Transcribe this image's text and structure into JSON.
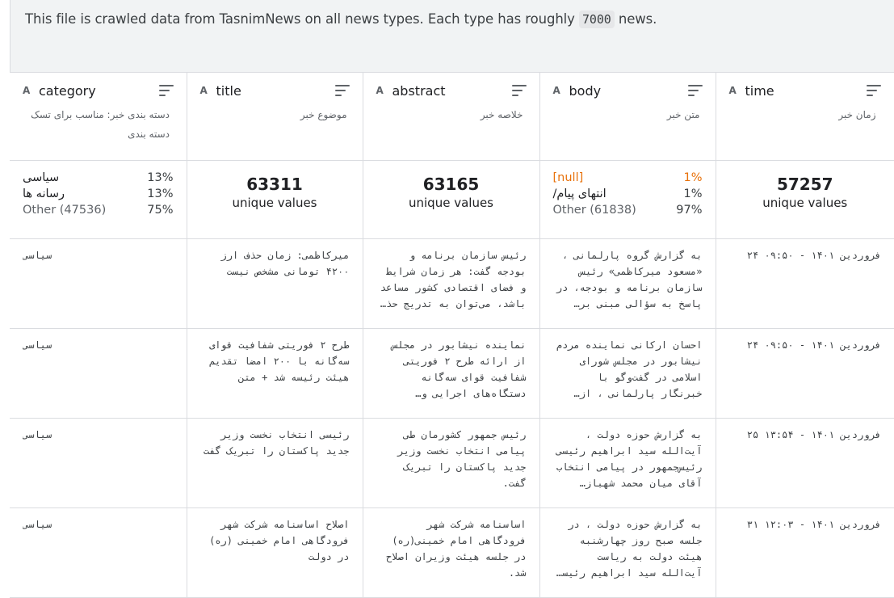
{
  "description": {
    "before": "This file is crawled data from TasnimNews on all news types. Each type has roughly ",
    "code": "7000",
    "after": " news."
  },
  "columns": [
    {
      "name": "category",
      "type_icon": "string-type-icon",
      "type_glyph": "A",
      "desc": "دسته بندی خبر: مناسب برای تسک دسته بندی"
    },
    {
      "name": "title",
      "type_icon": "string-type-icon",
      "type_glyph": "A",
      "desc": "موضوع خبر"
    },
    {
      "name": "abstract",
      "type_icon": "string-type-icon",
      "type_glyph": "A",
      "desc": "خلاصه خبر"
    },
    {
      "name": "body",
      "type_icon": "string-type-icon",
      "type_glyph": "A",
      "desc": "متن خبر"
    },
    {
      "name": "time",
      "type_icon": "string-type-icon",
      "type_glyph": "A",
      "desc": "زمان خبر"
    }
  ],
  "stats": {
    "category": [
      {
        "label": "سیاسی",
        "pct": "13%"
      },
      {
        "label": "رسانه ها",
        "pct": "13%"
      },
      {
        "label": "Other (47536)",
        "pct": "75%"
      }
    ],
    "title": {
      "count": "63311",
      "label": "unique values"
    },
    "abstract": {
      "count": "63165",
      "label": "unique values"
    },
    "body": [
      {
        "label": "[null]",
        "pct": "1%"
      },
      {
        "label": "/انتهای پیام",
        "pct": "1%"
      },
      {
        "label": "Other (61838)",
        "pct": "97%"
      }
    ],
    "time": {
      "count": "57257",
      "label": "unique values"
    }
  },
  "rows": [
    {
      "category": "سیاسی",
      "title": "میرکاظمی: زمان حذف ارز ۴۲۰۰ تومانی مشخص نیست",
      "abstract": "رئیس سازمان برنامه و بودجه گفت: هر زمان شرایط و فضای اقتصادی کشور مساعد باشد، می‌توان به تدریج حذف ...",
      "body": "به گزارش گروه پارلمانی ، «مسعود میرکاظمی» رئیس سازمان برنامه و بودجه، در پاسخ به سؤالی مبنی بر اینک...",
      "time": "فروردین ۱۴۰۱ - ۰۹:۵۰ ۲۴"
    },
    {
      "category": "سیاسی",
      "title": "طرح ۲ فوریتی شفافیت قوای سه‌گانه با ۲۰۰ امضا تقدیم هیئت رئیسه شد + متن",
      "abstract": "نماینده نیشابور در مجلس از ارائه طرح ۲ فوریتی شفافیت قوای سه‌گانه دستگاه‌های اجرایی و نهادهای عمومی...",
      "body": "احسان ارکانی نماینده مردم نیشابور در مجلس شورای اسلامی در گفت‌وگو با خبرنگار پارلمانی ، از ارائه طر...",
      "time": "فروردین ۱۴۰۱ - ۰۹:۵۰ ۲۴"
    },
    {
      "category": "سیاسی",
      "title": "رئیسی انتخاب نخست وزیر جدید پاکستان را تبریک گفت",
      "abstract": "رئیس جمهور کشورمان طی پیامی انتخاب نخست وزیر جدید پاکستان را تبریک گفت.",
      "body": "به گزارش حوزه دولت ، آیت‌الله سید ابراهیم رئیسی رئیس‌جمهور در پیامی انتخاب آقای میان محمد شهباز شری...",
      "time": "فروردین ۱۴۰۱ - ۱۳:۵۴ ۲۵"
    },
    {
      "category": "سیاسی",
      "title": "اصلاح اساسنامه شرکت شهر فرودگاهی امام خمینی (ره) در دولت",
      "abstract": "اساسنامه شرکت شهر فرودگاهی امام خمینی(ره) در جلسه هیئت وزیران اصلاح شد.",
      "body": "به گزارش حوزه دولت ، در جلسه صبح روز چهارشنبه هیئت دولت به ریاست آیت‌الله سید ابراهیم رئیسی رئیس‌جم...",
      "time": "فروردین ۱۴۰۱ - ۱۲:۰۳ ۳۱"
    }
  ]
}
